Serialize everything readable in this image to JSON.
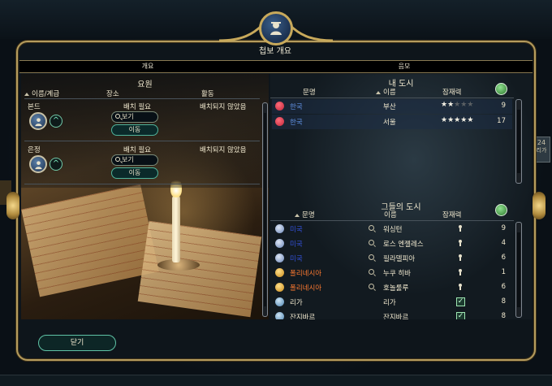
{
  "window": {
    "title": "첩보 개요",
    "tabs": [
      "개요",
      "음모"
    ]
  },
  "background": {
    "right_tab_number": "24",
    "right_tab_label": "리가"
  },
  "spies_panel": {
    "title": "요원",
    "columns": {
      "name_rank": "이름/계급",
      "location": "장소",
      "activity": "활동"
    },
    "spies": [
      {
        "name": "본드",
        "location": "배치 필요",
        "activity": "배치되지 않았음",
        "view_label": "보기",
        "move_label": "이동"
      },
      {
        "name": "은정",
        "location": "배치 필요",
        "activity": "배치되지 않았음",
        "view_label": "보기",
        "move_label": "이동"
      }
    ]
  },
  "your_cities": {
    "title": "내 도시",
    "columns": {
      "civ": "문명",
      "name": "이름",
      "potential": "잠재력"
    },
    "rows": [
      {
        "civ": "한국",
        "city": "부산",
        "stars": 2,
        "value": "9",
        "civ_color": "#5f8fe0",
        "icon_color": "#c0283a"
      },
      {
        "civ": "한국",
        "city": "서울",
        "stars": 5,
        "value": "17",
        "civ_color": "#5f8fe0",
        "icon_color": "#c0283a"
      }
    ]
  },
  "their_cities": {
    "title": "그들의 도시",
    "columns": {
      "civ": "문명",
      "name": "이름",
      "potential": "잠재력"
    },
    "rows": [
      {
        "civ": "미국",
        "city": "워싱턴",
        "indicator": "pin",
        "value": "9",
        "civ_color": "#3350d8",
        "icon_color": "#9fb3d6",
        "searchable": true
      },
      {
        "civ": "미국",
        "city": "로스 엔젤레스",
        "indicator": "pin",
        "value": "4",
        "civ_color": "#3350d8",
        "icon_color": "#9fb3d6",
        "searchable": true
      },
      {
        "civ": "미국",
        "city": "필라델피아",
        "indicator": "pin",
        "value": "6",
        "civ_color": "#3350d8",
        "icon_color": "#9fb3d6",
        "searchable": true
      },
      {
        "civ": "폴리네시아",
        "city": "누쿠 히바",
        "indicator": "pin",
        "value": "1",
        "civ_color": "#ff7a30",
        "icon_color": "#e8a92c",
        "searchable": true
      },
      {
        "civ": "폴리네시아",
        "city": "호놀룰루",
        "indicator": "pin",
        "value": "6",
        "civ_color": "#ff7a30",
        "icon_color": "#e8a92c",
        "searchable": true
      },
      {
        "civ": "리가",
        "city": "리가",
        "indicator": "check",
        "value": "8",
        "civ_color": "#f2ead0",
        "icon_color": "#7ab0d8",
        "searchable": false
      },
      {
        "civ": "잔지바르",
        "city": "잔지바르",
        "indicator": "check",
        "value": "8",
        "civ_color": "#f2ead0",
        "icon_color": "#7ab0d8",
        "searchable": false
      }
    ]
  },
  "footer": {
    "close_label": "닫기"
  }
}
